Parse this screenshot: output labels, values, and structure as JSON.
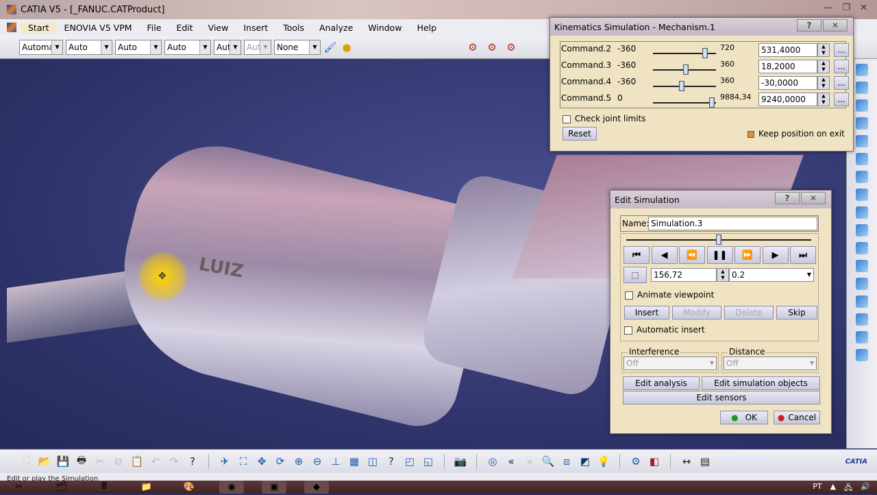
{
  "window": {
    "title": "CATIA V5 - [_FANUC.CATProduct]",
    "controls": [
      "—",
      "❐",
      "✕"
    ]
  },
  "menu": [
    "Start",
    "ENOVIA V5 VPM",
    "File",
    "Edit",
    "View",
    "Insert",
    "Tools",
    "Analyze",
    "Window",
    "Help"
  ],
  "toolbar": {
    "combos": [
      {
        "value": "Automa",
        "disabled": false
      },
      {
        "value": "Auto",
        "disabled": false
      },
      {
        "value": "Auto",
        "disabled": false
      },
      {
        "value": "Auto",
        "disabled": false
      },
      {
        "value": "Aut",
        "disabled": false
      },
      {
        "value": "Aut",
        "disabled": true
      },
      {
        "value": "None",
        "disabled": false
      }
    ]
  },
  "viewport": {
    "part_label": "LUIZ"
  },
  "kinematics": {
    "title": "Kinematics Simulation - Mechanism.1",
    "commands": [
      {
        "name": "Command.2",
        "min": "-360",
        "max": "720",
        "value": "531,4000",
        "position": 0.827
      },
      {
        "name": "Command.3",
        "min": "-360",
        "max": "360",
        "value": "18,2000",
        "position": 0.525
      },
      {
        "name": "Command.4",
        "min": "-360",
        "max": "360",
        "value": "-30,0000",
        "position": 0.458
      },
      {
        "name": "Command.5",
        "min": "0",
        "max": "9884,34",
        "value": "9240,0000",
        "position": 0.935
      }
    ],
    "more_label": "...",
    "check_joint_limits": "Check joint limits",
    "reset": "Reset",
    "keep_position": "Keep position on exit",
    "help": "?",
    "close": "✕"
  },
  "edit_sim": {
    "title": "Edit Simulation",
    "name_label": "Name:",
    "name_value": "Simulation.3",
    "timeline_position": 0.5,
    "player": [
      "⏮",
      "◀",
      "⏪",
      "❚❚",
      "⏩",
      "▶",
      "⏭"
    ],
    "step_value": "156,72",
    "interval": "0.2",
    "animate_viewpoint": "Animate viewpoint",
    "insert": "Insert",
    "modify": "Modify",
    "delete": "Delete",
    "skip": "Skip",
    "automatic_insert": "Automatic insert",
    "interference_label": "Interference",
    "interference_value": "Off",
    "distance_label": "Distance",
    "distance_value": "Off",
    "edit_analysis": "Edit analysis",
    "edit_sim_objects": "Edit simulation objects",
    "edit_sensors": "Edit sensors",
    "ok": "OK",
    "cancel": "Cancel",
    "help": "?",
    "close": "✕"
  },
  "status": {
    "text": "Edit or play the Simulation"
  },
  "brand": "CATIA",
  "taskbar": {
    "lang": "PT"
  }
}
